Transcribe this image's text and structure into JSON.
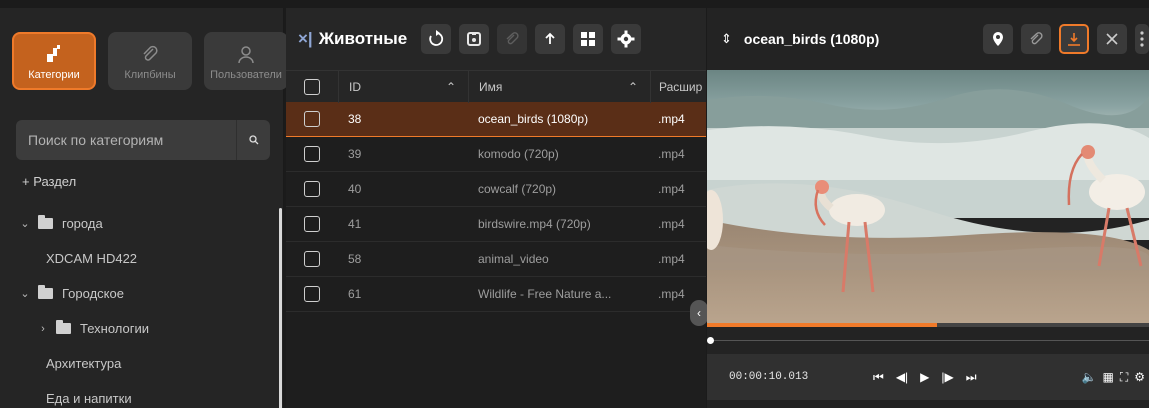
{
  "sidebar": {
    "tabs": [
      {
        "label": "Категории",
        "icon": "category-icon",
        "active": true
      },
      {
        "label": "Клипбины",
        "icon": "paperclip-icon",
        "active": false
      },
      {
        "label": "Пользователи",
        "icon": "user-icon",
        "active": false
      }
    ],
    "search_placeholder": "Поиск по категориям",
    "add_section_label": "+ Раздел",
    "tree": [
      {
        "label": "города",
        "level": 0,
        "type": "folder",
        "expanded": true
      },
      {
        "label": "XDCAM HD422",
        "level": 1,
        "type": "leaf"
      },
      {
        "label": "Городское",
        "level": 0,
        "type": "folder",
        "expanded": true
      },
      {
        "label": "Технологии",
        "level": 1,
        "type": "folder",
        "expanded": false
      },
      {
        "label": "Архитектура",
        "level": 1,
        "type": "leaf"
      },
      {
        "label": "Еда и напитки",
        "level": 1,
        "type": "leaf"
      }
    ]
  },
  "middle": {
    "title": "Животные",
    "columns": {
      "id": "ID",
      "name": "Имя",
      "ext": "Расшир"
    },
    "rows": [
      {
        "id": "38",
        "name": "ocean_birds (1080p)",
        "ext": ".mp4",
        "selected": true
      },
      {
        "id": "39",
        "name": "komodo (720p)",
        "ext": ".mp4",
        "selected": false
      },
      {
        "id": "40",
        "name": "cowcalf (720p)",
        "ext": ".mp4",
        "selected": false
      },
      {
        "id": "41",
        "name": "birdswire.mp4 (720p)",
        "ext": ".mp4",
        "selected": false
      },
      {
        "id": "58",
        "name": "animal_video",
        "ext": ".mp4",
        "selected": false
      },
      {
        "id": "61",
        "name": "Wildlife - Free Nature a...",
        "ext": ".mp4",
        "selected": false
      }
    ]
  },
  "player": {
    "title": "ocean_birds (1080p)",
    "timecode": "00:00:10.013",
    "progress_fraction": 0.52
  },
  "colors": {
    "accent": "#ef7a2a",
    "selected_row": "#5a2e17"
  }
}
